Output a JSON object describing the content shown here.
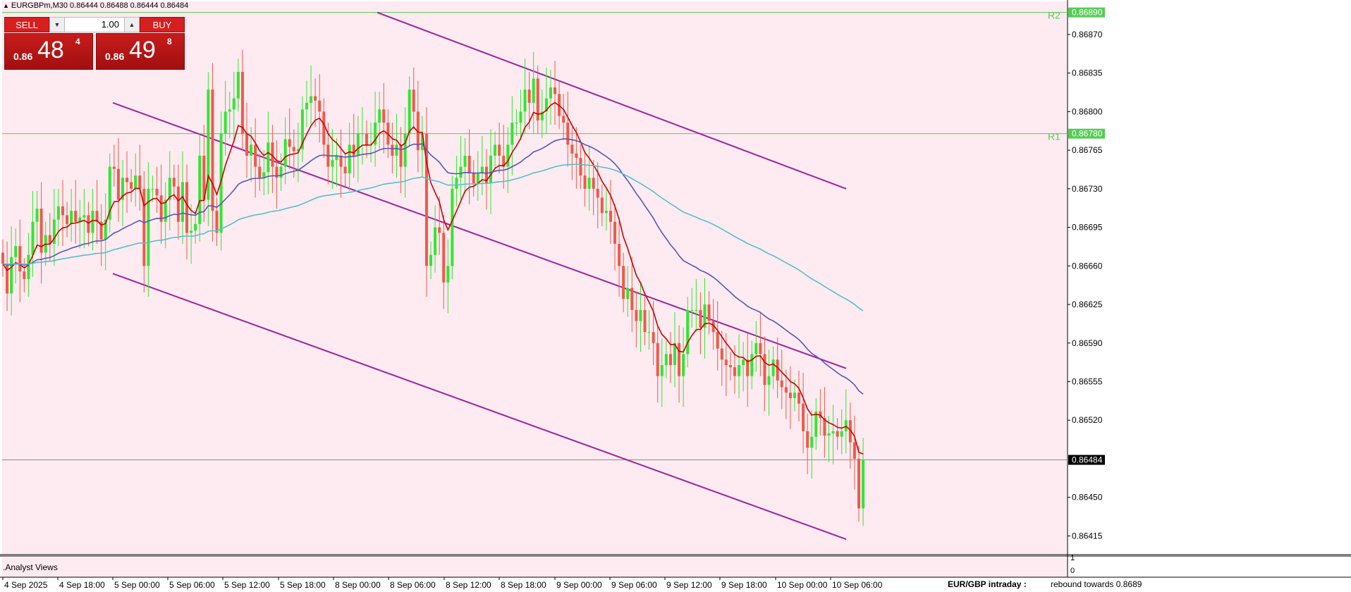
{
  "header": {
    "title": "EURGBPm,M30  0.86444 0.86488 0.86444 0.86484"
  },
  "trade_panel": {
    "sell_label": "SELL",
    "buy_label": "BUY",
    "lot_value": "1.00",
    "sell_prefix": "0.86",
    "sell_big": "48",
    "sell_sup": "4",
    "buy_prefix": "0.86",
    "buy_big": "49",
    "buy_sup": "8"
  },
  "subwindow": {
    "title": ".Analyst Views",
    "scale_top": "1",
    "scale_bottom": "0",
    "annotation_label": "EUR/GBP intraday :",
    "annotation_value": "rebound towards 0.8689"
  },
  "colors": {
    "background": "#fdebf1",
    "bull": "#32e632",
    "bear": "#ee5a4a",
    "ma_fast": "#cc0000",
    "ma_mid": "#5555bb",
    "ma_slow": "#55c0c8",
    "channel": "#a020a0",
    "level": "#55cc55"
  },
  "chart_data": {
    "type": "candlestick",
    "symbol": "EURGBPm",
    "timeframe": "M30",
    "ylim": [
      0.86398,
      0.869
    ],
    "y_ticks": [
      "0.86870",
      "0.86835",
      "0.86800",
      "0.86765",
      "0.86730",
      "0.86695",
      "0.86660",
      "0.86625",
      "0.86590",
      "0.86555",
      "0.86520",
      "0.86450",
      "0.86415"
    ],
    "x_labels": [
      "4 Sep 2025",
      "4 Sep 18:00",
      "5 Sep 00:00",
      "5 Sep 06:00",
      "5 Sep 12:00",
      "5 Sep 18:00",
      "8 Sep 00:00",
      "8 Sep 06:00",
      "8 Sep 12:00",
      "8 Sep 18:00",
      "9 Sep 00:00",
      "9 Sep 06:00",
      "9 Sep 12:00",
      "9 Sep 18:00",
      "10 Sep 00:00",
      "10 Sep 06:00"
    ],
    "levels": [
      {
        "name": "R2",
        "value": 0.8689,
        "label": "0.86890"
      },
      {
        "name": "R1",
        "value": 0.8678,
        "label": "0.86780"
      }
    ],
    "current_price": {
      "value": 0.86484,
      "label": "0.86484"
    },
    "closes": [
      0.86662,
      0.86635,
      0.86668,
      0.86678,
      0.86655,
      0.86648,
      0.8667,
      0.867,
      0.86712,
      0.86672,
      0.86688,
      0.8668,
      0.86702,
      0.86714,
      0.86706,
      0.86698,
      0.8671,
      0.867,
      0.86704,
      0.86706,
      0.8669,
      0.8671,
      0.867,
      0.86684,
      0.86702,
      0.8675,
      0.86748,
      0.8672,
      0.8674,
      0.86736,
      0.8673,
      0.86742,
      0.8673,
      0.8666,
      0.8673,
      0.8673,
      0.86724,
      0.867,
      0.8672,
      0.8674,
      0.86732,
      0.867,
      0.86736,
      0.8669,
      0.86692,
      0.86698,
      0.8676,
      0.8672,
      0.8682,
      0.8671,
      0.8669,
      0.8678,
      0.868,
      0.86802,
      0.86812,
      0.86836,
      0.8678,
      0.8676,
      0.8677,
      0.8675,
      0.8674,
      0.86745,
      0.86772,
      0.8675,
      0.8674,
      0.8675,
      0.86775,
      0.86768,
      0.86764,
      0.86766,
      0.86802,
      0.86808,
      0.86814,
      0.8681,
      0.868,
      0.8677,
      0.8675,
      0.86756,
      0.8676,
      0.8675,
      0.86744,
      0.8677,
      0.8676,
      0.8678,
      0.8678,
      0.8677,
      0.8677,
      0.8679,
      0.86802,
      0.8679,
      0.8677,
      0.8676,
      0.8677,
      0.8675,
      0.8678,
      0.8682,
      0.868,
      0.86765,
      0.8678,
      0.8666,
      0.8667,
      0.86695,
      0.8669,
      0.86645,
      0.8666,
      0.8673,
      0.8674,
      0.8675,
      0.8676,
      0.86744,
      0.86735,
      0.86744,
      0.8675,
      0.86735,
      0.8676,
      0.8677,
      0.8676,
      0.8675,
      0.8677,
      0.8679,
      0.8679,
      0.868,
      0.8682,
      0.86808,
      0.8683,
      0.86792,
      0.868,
      0.86812,
      0.86822,
      0.86816,
      0.86796,
      0.8679,
      0.8677,
      0.86762,
      0.86758,
      0.86742,
      0.8673,
      0.8674,
      0.8673,
      0.86722,
      0.86708,
      0.8671,
      0.867,
      0.8668,
      0.8666,
      0.8663,
      0.8664,
      0.8662,
      0.8661,
      0.8662,
      0.866,
      0.866,
      0.8659,
      0.8656,
      0.8657,
      0.8658,
      0.8657,
      0.8659,
      0.8656,
      0.8658,
      0.8662,
      0.8662,
      0.8662,
      0.86604,
      0.86625,
      0.8661,
      0.866,
      0.86585,
      0.86575,
      0.8657,
      0.86568,
      0.8656,
      0.8657,
      0.86575,
      0.8656,
      0.8658,
      0.8659,
      0.8658,
      0.86552,
      0.8656,
      0.86575,
      0.86556,
      0.8655,
      0.86545,
      0.8654,
      0.86545,
      0.86535,
      0.8651,
      0.86495,
      0.86505,
      0.86528,
      0.86522,
      0.86506,
      0.86508,
      0.8651,
      0.86505,
      0.8651,
      0.8652,
      0.865,
      0.86485,
      0.8644,
      0.86484
    ]
  }
}
